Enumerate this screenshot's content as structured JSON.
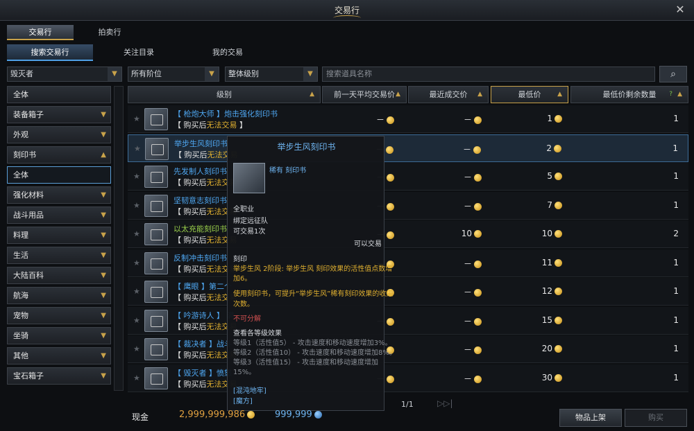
{
  "window": {
    "title": "交易行",
    "close": "✕"
  },
  "main_tabs": [
    {
      "label": "交易行",
      "active": true
    },
    {
      "label": "拍卖行",
      "active": false
    }
  ],
  "sub_tabs": [
    {
      "label": "搜索交易行",
      "active": true
    },
    {
      "label": "关注目录",
      "active": false
    },
    {
      "label": "我的交易",
      "active": false
    }
  ],
  "filters": {
    "class_value": "毁灭者",
    "tier_value": "所有阶位",
    "grade_value": "整体级别",
    "search_placeholder": "搜索道具名称"
  },
  "categories": [
    {
      "label": "全体",
      "expandable": false
    },
    {
      "label": "装备箱子",
      "expandable": true
    },
    {
      "label": "外观",
      "expandable": true
    },
    {
      "label": "刻印书",
      "expandable": true,
      "expanded": true
    },
    {
      "label": "全体",
      "expandable": false,
      "selected": true
    },
    {
      "label": "强化材料",
      "expandable": true
    },
    {
      "label": "战斗用品",
      "expandable": true
    },
    {
      "label": "料理",
      "expandable": true
    },
    {
      "label": "生活",
      "expandable": true
    },
    {
      "label": "大陆百科",
      "expandable": true
    },
    {
      "label": "航海",
      "expandable": true
    },
    {
      "label": "宠物",
      "expandable": true
    },
    {
      "label": "坐骑",
      "expandable": true
    },
    {
      "label": "其他",
      "expandable": true
    },
    {
      "label": "宝石箱子",
      "expandable": true
    }
  ],
  "table_headers": [
    "级别",
    "前一天平均交易价",
    "最近成交价",
    "最低价",
    "最低价剩余数量"
  ],
  "rows": [
    {
      "name": "【 枪炮大师 】炮击强化刻印书",
      "sub_a": "【 购买后",
      "sub_b": "无法交易",
      "sub_c": " 】",
      "avg": "－",
      "recent": "－",
      "lowest": "1",
      "qty": "1"
    },
    {
      "name": "举步生风刻印书",
      "sub_a": "【 购买后",
      "sub_b": "无法交易",
      "sub_c": "",
      "avg": "－",
      "recent": "－",
      "lowest": "2",
      "qty": "1"
    },
    {
      "name": "先发制人刻印书",
      "sub_a": "【 购买后",
      "sub_b": "无法交易",
      "sub_c": "",
      "avg": "－",
      "recent": "－",
      "lowest": "5",
      "qty": "1"
    },
    {
      "name": "坚韧意志刻印书",
      "sub_a": "【 购买后",
      "sub_b": "无法交易",
      "sub_c": "",
      "avg": "－",
      "recent": "－",
      "lowest": "7",
      "qty": "1"
    },
    {
      "name": "以太充能刻印书",
      "sub_a": "【 购买后",
      "sub_b": "无法交易",
      "sub_c": "",
      "avg": "－",
      "recent": "10",
      "lowest": "10",
      "qty": "2",
      "green": true
    },
    {
      "name": "反制冲击刻印书",
      "sub_a": "【 购买后",
      "sub_b": "无法交易",
      "sub_c": "",
      "avg": "－",
      "recent": "－",
      "lowest": "11",
      "qty": "1"
    },
    {
      "name": "【 鹰眼 】第二个",
      "sub_a": "【 购买后",
      "sub_b": "无法交易",
      "sub_c": "",
      "avg": "－",
      "recent": "－",
      "lowest": "12",
      "qty": "1"
    },
    {
      "name": "【 吟游诗人 】 满",
      "sub_a": "【 购买后",
      "sub_b": "无法交易",
      "sub_c": "",
      "avg": "－",
      "recent": "－",
      "lowest": "15",
      "qty": "1"
    },
    {
      "name": "【 裁决者 】战斗",
      "sub_a": "【 购买后",
      "sub_b": "无法交易",
      "sub_c": "",
      "avg": "－",
      "recent": "－",
      "lowest": "20",
      "qty": "1"
    },
    {
      "name": "【 毁灭者 】愤怒",
      "sub_a": "【 购买后",
      "sub_b": "无法交易",
      "sub_c": "",
      "avg": "－",
      "recent": "－",
      "lowest": "30",
      "qty": "1"
    }
  ],
  "tooltip": {
    "title": "举步生风刻印书",
    "grade": "稀有 刻印书",
    "class": "全职业",
    "bind": "绑定远征队",
    "trades": "可交易1次",
    "tradeable": "可以交易",
    "section": "刻印",
    "effect": "举步生风 2阶段: 举步生风 刻印效果的活性值点数增",
    "effect2": "加6。",
    "desc": "使用刻印书，可提升“举步生风”稀有刻印效果的收集",
    "desc2": "次数。",
    "no_split": "不可分解",
    "levels_title": "查看各等级效果",
    "lv1": "等级1（活性值5） - 攻击速度和移动速度增加3%。",
    "lv2": "等级2（活性值10） - 攻击速度和移动速度增加8%。",
    "lv3": "等级3（活性值15） - 攻击速度和移动速度增加",
    "lv3b": "15%。",
    "src1": "[混沌地牢]",
    "src2": "[魔方]"
  },
  "pagination": "1/1",
  "footer": {
    "cash_label": "现金",
    "gold": "2,999,999,986",
    "crystal": "999,999",
    "sell_button": "物品上架",
    "buy_button": "购买"
  }
}
